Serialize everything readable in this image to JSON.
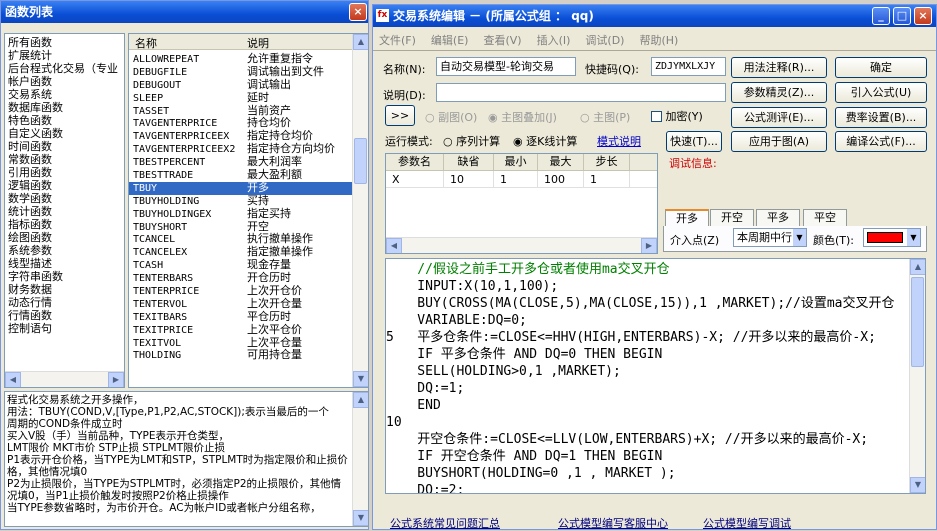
{
  "left": {
    "title": "函数列表",
    "close": "×",
    "categories": [
      "所有函数",
      "扩展统计",
      "后台程式化交易（专业",
      "帐户函数",
      "交易系统",
      "数据库函数",
      "特色函数",
      "自定义函数",
      "时间函数",
      "常数函数",
      "引用函数",
      "逻辑函数",
      "数学函数",
      "统计函数",
      "指标函数",
      "绘图函数",
      "系统参数",
      "线型描述",
      "字符串函数",
      "财务数据",
      "动态行情",
      "行情函数",
      "控制语句"
    ],
    "col_name": "名称",
    "col_desc": "说明",
    "funcs": [
      {
        "n": "ALLOWREPEAT",
        "d": "允许重复指令"
      },
      {
        "n": "DEBUGFILE",
        "d": "调试输出到文件"
      },
      {
        "n": "DEBUGOUT",
        "d": "调试输出"
      },
      {
        "n": "SLEEP",
        "d": "延时"
      },
      {
        "n": "TASSET",
        "d": "当前资产"
      },
      {
        "n": "TAVGENTERPRICE",
        "d": "持仓均价"
      },
      {
        "n": "TAVGENTERPRICEEX",
        "d": "指定持仓均价"
      },
      {
        "n": "TAVGENTERPRICEEX2",
        "d": "指定持仓方向均价"
      },
      {
        "n": "TBESTPERCENT",
        "d": "最大利润率"
      },
      {
        "n": "TBESTTRADE",
        "d": "最大盈利额"
      },
      {
        "n": "TBUY",
        "d": "开多"
      },
      {
        "n": "TBUYHOLDING",
        "d": "买持"
      },
      {
        "n": "TBUYHOLDINGEX",
        "d": "指定买持"
      },
      {
        "n": "TBUYSHORT",
        "d": "开空"
      },
      {
        "n": "TCANCEL",
        "d": "执行撤单操作"
      },
      {
        "n": "TCANCELEX",
        "d": "指定撤单操作"
      },
      {
        "n": "TCASH",
        "d": "现金存量"
      },
      {
        "n": "TENTERBARS",
        "d": "开仓历时"
      },
      {
        "n": "TENTERPRICE",
        "d": "上次开仓价"
      },
      {
        "n": "TENTERVOL",
        "d": "上次开仓量"
      },
      {
        "n": "TEXITBARS",
        "d": "平仓历时"
      },
      {
        "n": "TEXITPRICE",
        "d": "上次平仓价"
      },
      {
        "n": "TEXITVOL",
        "d": "上次平仓量"
      },
      {
        "n": "THOLDING",
        "d": "可用持仓量"
      }
    ],
    "help": [
      "程式化交易系统之开多操作，",
      "用法：TBUY(COND,V,[Type,P1,P2,AC,STOCK]);表示当最后的一个",
      "周期的COND条件成立时",
      "买入V股（手）当前品种，TYPE表示开仓类型，",
      "LMT限价 MKT市价 STP止损 STPLMT限价止损",
      "P1表示开仓价格，当TYPE为LMT和STP，STPLMT时为指定限价和止损价格，其他情况填0",
      "P2为止损限价，当TYPE为STPLMT时，必须指定P2的止损限价，其他情况填0，当P1止损价触发时按照P2价格止损操作",
      "当TYPE参数省略时，为市价开仓。AC为帐户ID或者帐户分组名称，"
    ]
  },
  "right": {
    "title": "交易系统编辑 － (所属公式组 ： qq)",
    "menu": [
      "文件(F)",
      "编辑(E)",
      "查看(V)",
      "插入(I)",
      "调试(D)",
      "帮助(H)"
    ],
    "name_label": "名称(N):",
    "name_value": "自动交易模型-轮询交易",
    "shortcut_label": "快捷码(Q):",
    "shortcut_value": "ZDJYMXLXJY",
    "desc_label": "说明(D):",
    "desc_value": "",
    "expand": ">>",
    "radio_sub": "副图(O)",
    "radio_main_overlay": "主图叠加(J)",
    "radio_main": "主图(P)",
    "encrypt": "加密(Y)",
    "run_mode_label": "运行模式:",
    "seq_label": "序列计算",
    "bar_label": "逐K线计算",
    "mode_help": "模式说明",
    "buttons": {
      "usage": "用法注释(R)...",
      "param": "参数精灵(Z)...",
      "formula_test": "公式测评(E)...",
      "quick": "快速(T)...",
      "apply": "应用于图(A)",
      "ok": "确定",
      "cite": "引入公式(U)",
      "fee": "费率设置(B)...",
      "compile": "编译公式(F)..."
    },
    "param_headers": [
      "参数名",
      "缺省",
      "最小",
      "最大",
      "步长"
    ],
    "param_rows": [
      [
        "X",
        "10",
        "1",
        "100",
        "1"
      ]
    ],
    "debug_label": "调试信息:",
    "tabs": [
      "开多",
      "开空",
      "平多",
      "平空"
    ],
    "entry_label": "介入点(Z)",
    "entry_value": "本周期中行",
    "color_label": "颜色(T):",
    "color": "#ff0000",
    "code": [
      "    //假设之前手工开多仓或者使用ma交叉开仓",
      "    INPUT:X(10,1,100);",
      "    BUY(CROSS(MA(CLOSE,5),MA(CLOSE,15)),1 ,MARKET);//设置ma交叉开仓",
      "    VARIABLE:DQ=0;",
      "5   平多仓条件:=CLOSE<=HHV(HIGH,ENTERBARS)-X; //开多以来的最高价-X;",
      "    IF 平多仓条件 AND DQ=0 THEN BEGIN",
      "    SELL(HOLDING>0,1 ,MARKET);",
      "    DQ:=1;",
      "    END",
      "10  ",
      "    开空仓条件:=CLOSE<=LLV(LOW,ENTERBARS)+X; //开多以来的最高价-X;",
      "    IF 开空仓条件 AND DQ=1 THEN BEGIN",
      "    BUYSHORT(HOLDING=0 ,1 , MARKET );",
      "    DQ:=2;"
    ],
    "links": [
      "公式系统常见问题汇总",
      "公式模型编写客服中心",
      "公式模型编写调试"
    ]
  }
}
